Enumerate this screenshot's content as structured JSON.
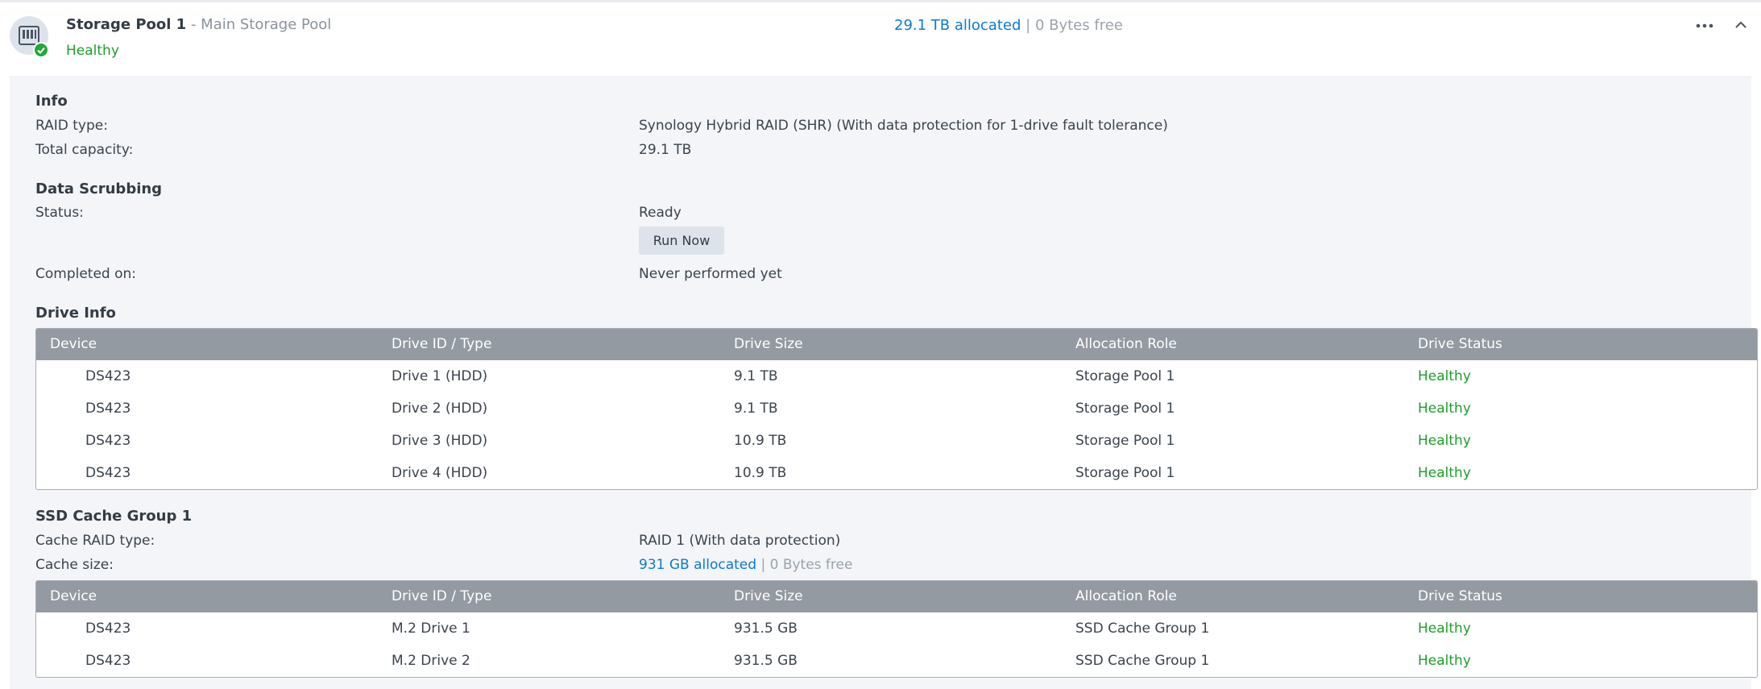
{
  "header": {
    "pool_name": "Storage Pool 1",
    "separator": "-",
    "pool_description": "Main Storage Pool",
    "health": "Healthy",
    "allocated": "29.1 TB allocated",
    "divider": "|",
    "free": "0 Bytes free",
    "icons": [
      "nas-pool-icon",
      "check-icon",
      "more-icon",
      "chevron-up-icon"
    ]
  },
  "info": {
    "title": "Info",
    "raid_type_label": "RAID type:",
    "raid_type_value": "Synology Hybrid RAID (SHR) (With data protection for 1-drive fault tolerance)",
    "capacity_label": "Total capacity:",
    "capacity_value": "29.1 TB"
  },
  "scrubbing": {
    "title": "Data Scrubbing",
    "status_label": "Status:",
    "status_value": "Ready",
    "run_now_label": "Run Now",
    "completed_label": "Completed on:",
    "completed_value": "Never performed yet"
  },
  "drive_info": {
    "title": "Drive Info",
    "columns": [
      "Device",
      "Drive ID / Type",
      "Drive Size",
      "Allocation Role",
      "Drive Status"
    ],
    "rows": [
      {
        "device": "DS423",
        "drive": "Drive 1 (HDD)",
        "size": "9.1 TB",
        "role": "Storage Pool 1",
        "status": "Healthy"
      },
      {
        "device": "DS423",
        "drive": "Drive 2 (HDD)",
        "size": "9.1 TB",
        "role": "Storage Pool 1",
        "status": "Healthy"
      },
      {
        "device": "DS423",
        "drive": "Drive 3 (HDD)",
        "size": "10.9 TB",
        "role": "Storage Pool 1",
        "status": "Healthy"
      },
      {
        "device": "DS423",
        "drive": "Drive 4 (HDD)",
        "size": "10.9 TB",
        "role": "Storage Pool 1",
        "status": "Healthy"
      }
    ]
  },
  "cache": {
    "title": "SSD Cache Group 1",
    "raid_label": "Cache RAID type:",
    "raid_value": "RAID 1 (With data protection)",
    "size_label": "Cache size:",
    "allocated": "931 GB allocated",
    "divider": "|",
    "free": "0 Bytes free",
    "columns": [
      "Device",
      "Drive ID / Type",
      "Drive Size",
      "Allocation Role",
      "Drive Status"
    ],
    "rows": [
      {
        "device": "DS423",
        "drive": "M.2 Drive 1",
        "size": "931.5 GB",
        "role": "SSD Cache Group 1",
        "status": "Healthy"
      },
      {
        "device": "DS423",
        "drive": "M.2 Drive 2",
        "size": "931.5 GB",
        "role": "SSD Cache Group 1",
        "status": "Healthy"
      }
    ]
  },
  "colors": {
    "healthy": "#1c9f28",
    "link": "#0a7ad6",
    "table_header": "#939aa1",
    "panel_bg": "#f3f5f8"
  }
}
